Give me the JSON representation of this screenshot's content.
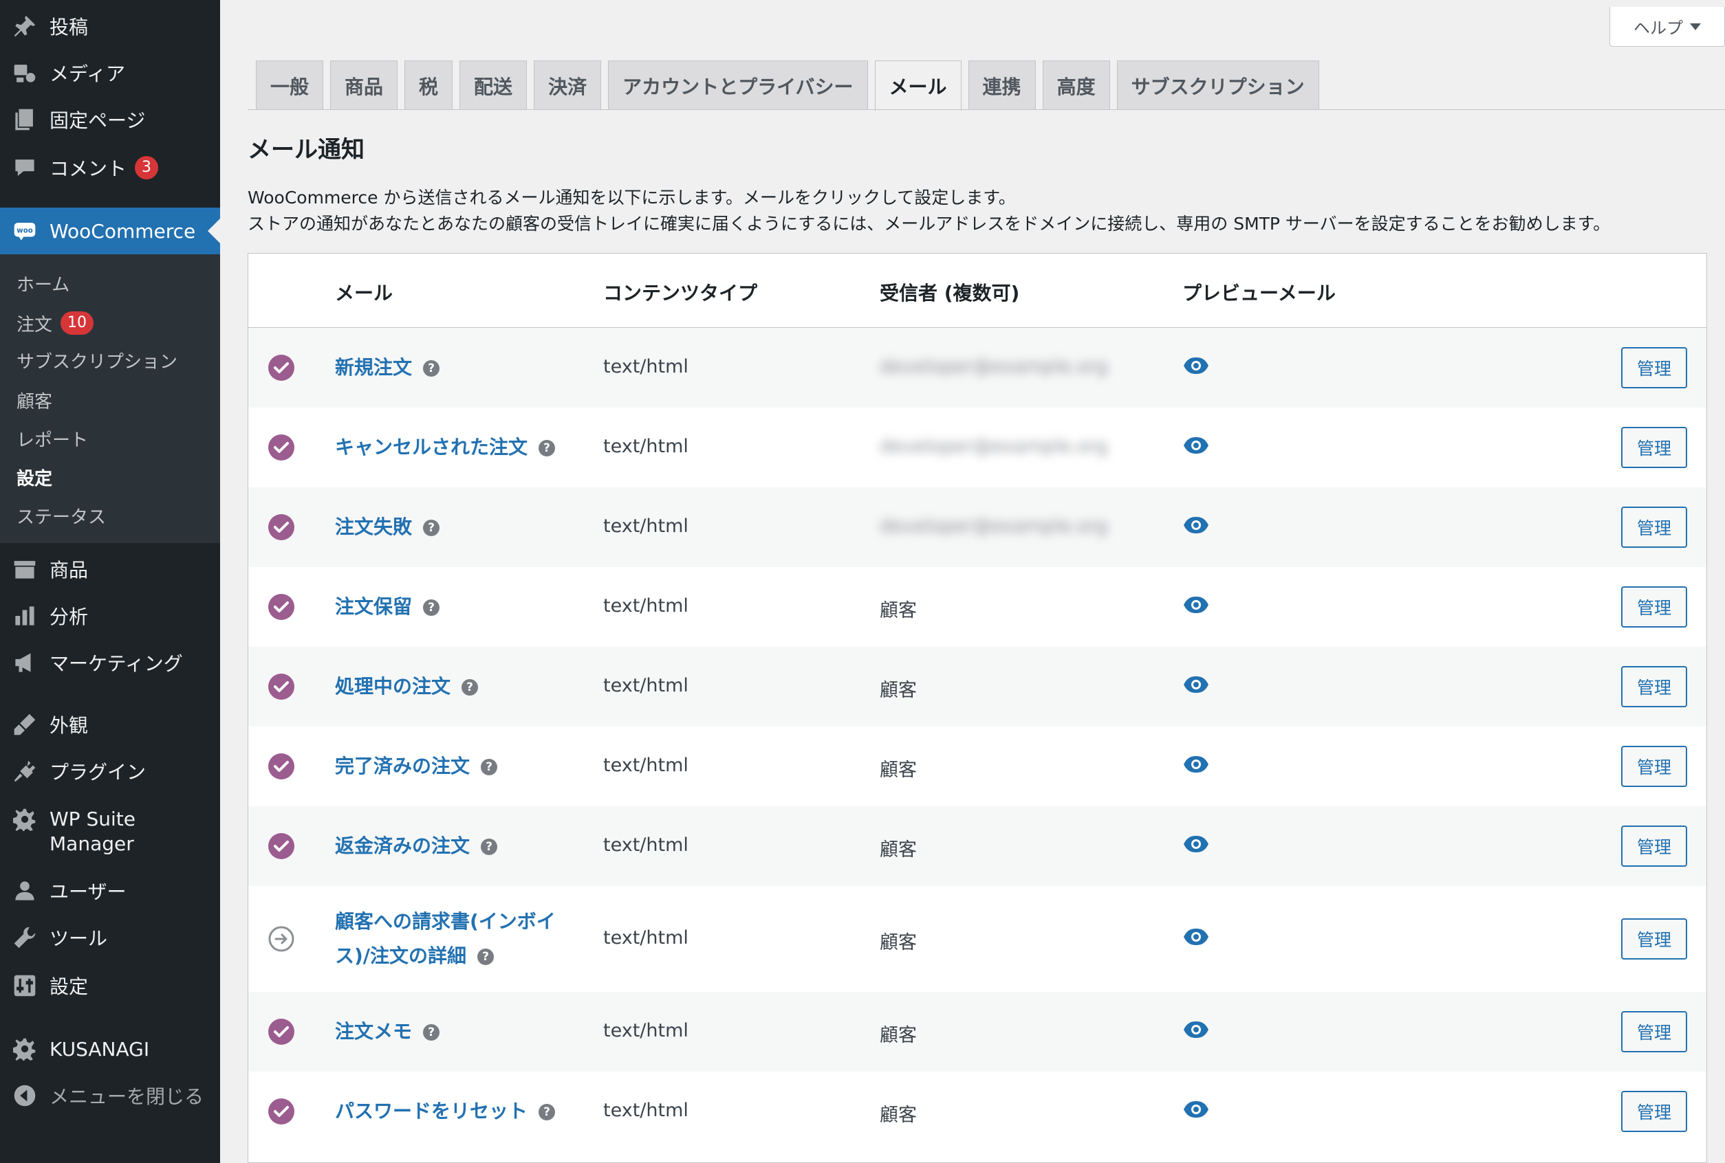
{
  "sidebar": {
    "top_items": [
      {
        "label": "投稿",
        "icon": "pin-icon"
      },
      {
        "label": "メディア",
        "icon": "media-icon"
      },
      {
        "label": "固定ページ",
        "icon": "pages-icon"
      },
      {
        "label": "コメント",
        "icon": "comment-icon",
        "badge": "3"
      }
    ],
    "woocommerce": {
      "label": "WooCommerce",
      "icon": "woo-icon"
    },
    "submenu": [
      "ホーム",
      "注文",
      "サブスクリプション",
      "顧客",
      "レポート",
      "設定",
      "ステータス"
    ],
    "orders_badge": "10",
    "bottom_items": [
      {
        "label": "商品",
        "icon": "products-icon"
      },
      {
        "label": "分析",
        "icon": "analytics-icon"
      },
      {
        "label": "マーケティング",
        "icon": "megaphone-icon"
      },
      {
        "label": "外観",
        "icon": "brush-icon"
      },
      {
        "label": "プラグイン",
        "icon": "plugin-icon"
      },
      {
        "label": "WP Suite",
        "label2": "Manager",
        "icon": "gear-icon"
      },
      {
        "label": "ユーザー",
        "icon": "user-icon"
      },
      {
        "label": "ツール",
        "icon": "wrench-icon"
      },
      {
        "label": "設定",
        "icon": "settings-icon"
      },
      {
        "label": "KUSANAGI",
        "icon": "gear-icon"
      },
      {
        "label": "メニューを閉じる",
        "icon": "collapse-icon"
      }
    ]
  },
  "help": {
    "label": "ヘルプ"
  },
  "tabs": [
    "一般",
    "商品",
    "税",
    "配送",
    "決済",
    "アカウントとプライバシー",
    "メール",
    "連携",
    "高度",
    "サブスクリプション"
  ],
  "active_tab": "メール",
  "page": {
    "title": "メール通知",
    "desc1": "WooCommerce から送信されるメール通知を以下に示します。メールをクリックして設定します。",
    "desc2": "ストアの通知があなたとあなたの顧客の受信トレイに確実に届くようにするには、メールアドレスをドメインに接続し、専用の SMTP サーバーを設定することをお勧めします。"
  },
  "table": {
    "headers": {
      "email": "メール",
      "content_type": "コンテンツタイプ",
      "recipient": "受信者 (複数可)",
      "preview": "プレビューメール"
    },
    "manage_label": "管理",
    "rows": [
      {
        "name": "新規注文",
        "type": "text/html",
        "recipient": "developer@example.org",
        "enabled": true
      },
      {
        "name": "キャンセルされた注文",
        "type": "text/html",
        "recipient": "developer@example.org",
        "enabled": true
      },
      {
        "name": "注文失敗",
        "type": "text/html",
        "recipient": "developer@example.org",
        "enabled": true
      },
      {
        "name": "注文保留",
        "type": "text/html",
        "recipient": "顧客",
        "enabled": true
      },
      {
        "name": "処理中の注文",
        "type": "text/html",
        "recipient": "顧客",
        "enabled": true
      },
      {
        "name": "完了済みの注文",
        "type": "text/html",
        "recipient": "顧客",
        "enabled": true
      },
      {
        "name": "返金済みの注文",
        "type": "text/html",
        "recipient": "顧客",
        "enabled": true
      },
      {
        "name": "顧客への請求書(インボイ",
        "name2": "ス)/注文の詳細",
        "type": "text/html",
        "recipient": "顧客",
        "enabled": false
      },
      {
        "name": "注文メモ",
        "type": "text/html",
        "recipient": "顧客",
        "enabled": true
      },
      {
        "name": "パスワードをリセット",
        "type": "text/html",
        "recipient": "顧客",
        "enabled": true
      }
    ]
  },
  "colors": {
    "sidebar": "#1d2327",
    "accent": "#2271b1",
    "enabled_check": "#9b5c8f",
    "badge": "#d63638"
  }
}
